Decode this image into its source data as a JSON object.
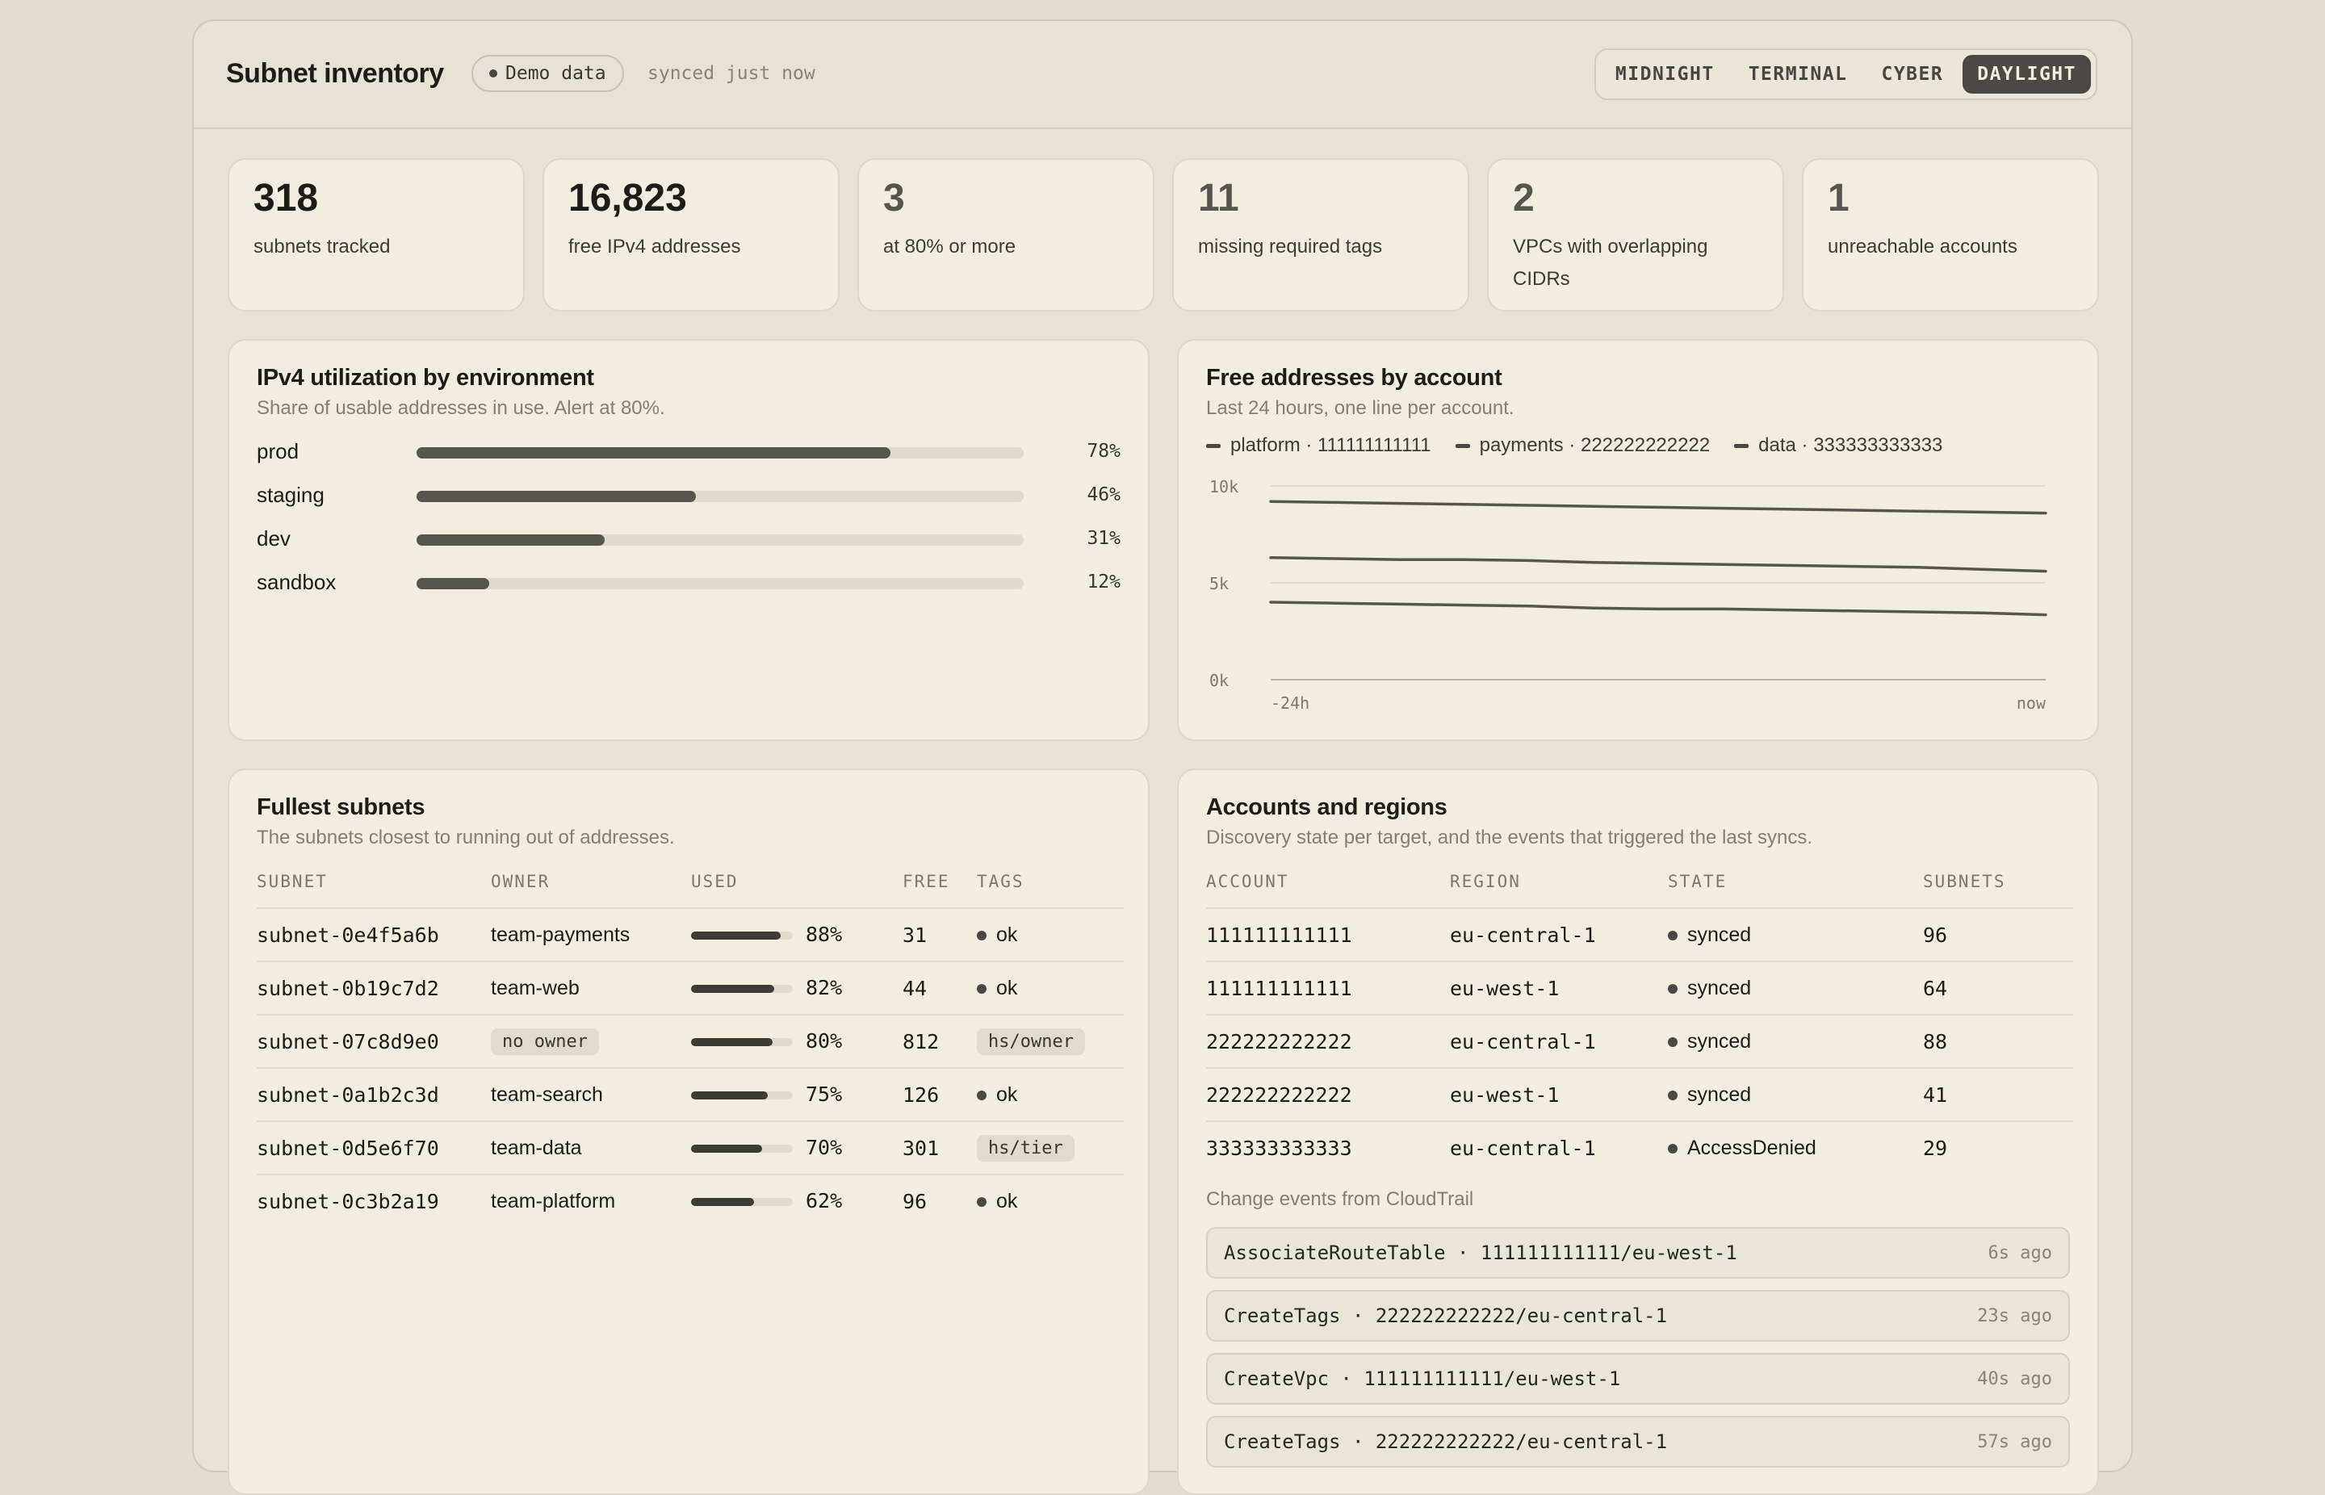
{
  "header": {
    "title": "Subnet inventory",
    "badge": "Demo data",
    "synced": "synced just now",
    "themes": [
      "MIDNIGHT",
      "TERMINAL",
      "CYBER",
      "DAYLIGHT"
    ],
    "active_theme": "DAYLIGHT"
  },
  "stats": [
    {
      "value": "318",
      "label": "subnets tracked"
    },
    {
      "value": "16,823",
      "label": "free IPv4 addresses"
    },
    {
      "value": "3",
      "label": "at 80% or more"
    },
    {
      "value": "11",
      "label": "missing required tags"
    },
    {
      "value": "2",
      "label": "VPCs with overlapping CIDRs"
    },
    {
      "value": "1",
      "label": "unreachable accounts"
    }
  ],
  "utilization": {
    "title": "IPv4 utilization by environment",
    "subtitle": "Share of usable addresses in use. Alert at 80%.",
    "rows": [
      {
        "env": "prod",
        "pct": 78,
        "pct_label": "78%"
      },
      {
        "env": "staging",
        "pct": 46,
        "pct_label": "46%"
      },
      {
        "env": "dev",
        "pct": 31,
        "pct_label": "31%"
      },
      {
        "env": "sandbox",
        "pct": 12,
        "pct_label": "12%"
      }
    ]
  },
  "free_chart": {
    "title": "Free addresses by account",
    "subtitle": "Last 24 hours, one line per account."
  },
  "chart_data": {
    "type": "line",
    "title": "Free addresses by account",
    "x": [
      "-24h",
      "-22h",
      "-20h",
      "-18h",
      "-16h",
      "-14h",
      "-12h",
      "-10h",
      "-8h",
      "-6h",
      "-4h",
      "-2h",
      "now"
    ],
    "x_tick_labels": [
      "-24h",
      "now"
    ],
    "y_tick_labels": [
      "10k",
      "5k",
      "0k"
    ],
    "ylim": [
      0,
      10000
    ],
    "grid": true,
    "legend_position": "top-left",
    "series": [
      {
        "name": "platform · 111111111111",
        "values": [
          9200,
          9150,
          9100,
          9050,
          9000,
          8950,
          8900,
          8850,
          8800,
          8750,
          8700,
          8650,
          8600
        ]
      },
      {
        "name": "payments · 222222222222",
        "values": [
          6300,
          6250,
          6200,
          6200,
          6150,
          6050,
          6000,
          5950,
          5900,
          5850,
          5800,
          5700,
          5600
        ]
      },
      {
        "name": "data · 333333333333",
        "values": [
          4000,
          3950,
          3900,
          3850,
          3800,
          3700,
          3650,
          3650,
          3600,
          3550,
          3500,
          3450,
          3350
        ]
      }
    ]
  },
  "fullest": {
    "title": "Fullest subnets",
    "subtitle": "The subnets closest to running out of addresses.",
    "columns": [
      "SUBNET",
      "OWNER",
      "USED",
      "FREE",
      "TAGS"
    ],
    "rows": [
      {
        "subnet": "subnet-0e4f5a6b",
        "owner": "team-payments",
        "owner_missing": false,
        "used": 88,
        "used_label": "88%",
        "free": "31",
        "tags": "ok",
        "tags_issue": false
      },
      {
        "subnet": "subnet-0b19c7d2",
        "owner": "team-web",
        "owner_missing": false,
        "used": 82,
        "used_label": "82%",
        "free": "44",
        "tags": "ok",
        "tags_issue": false
      },
      {
        "subnet": "subnet-07c8d9e0",
        "owner": "no owner",
        "owner_missing": true,
        "used": 80,
        "used_label": "80%",
        "free": "812",
        "tags": "hs/owner",
        "tags_issue": true
      },
      {
        "subnet": "subnet-0a1b2c3d",
        "owner": "team-search",
        "owner_missing": false,
        "used": 75,
        "used_label": "75%",
        "free": "126",
        "tags": "ok",
        "tags_issue": false
      },
      {
        "subnet": "subnet-0d5e6f70",
        "owner": "team-data",
        "owner_missing": false,
        "used": 70,
        "used_label": "70%",
        "free": "301",
        "tags": "hs/tier",
        "tags_issue": true
      },
      {
        "subnet": "subnet-0c3b2a19",
        "owner": "team-platform",
        "owner_missing": false,
        "used": 62,
        "used_label": "62%",
        "free": "96",
        "tags": "ok",
        "tags_issue": false
      }
    ]
  },
  "accounts": {
    "title": "Accounts and regions",
    "subtitle": "Discovery state per target, and the events that triggered the last syncs.",
    "columns": [
      "ACCOUNT",
      "REGION",
      "STATE",
      "SUBNETS"
    ],
    "rows": [
      {
        "account": "111111111111",
        "region": "eu-central-1",
        "state": "synced",
        "subnets": "96"
      },
      {
        "account": "111111111111",
        "region": "eu-west-1",
        "state": "synced",
        "subnets": "64"
      },
      {
        "account": "222222222222",
        "region": "eu-central-1",
        "state": "synced",
        "subnets": "88"
      },
      {
        "account": "222222222222",
        "region": "eu-west-1",
        "state": "synced",
        "subnets": "41"
      },
      {
        "account": "333333333333",
        "region": "eu-central-1",
        "state": "AccessDenied",
        "subnets": "29"
      }
    ],
    "events_title": "Change events from CloudTrail",
    "events": [
      {
        "text": "AssociateRouteTable · 111111111111/eu-west-1",
        "time": "6s ago"
      },
      {
        "text": "CreateTags · 222222222222/eu-central-1",
        "time": "23s ago"
      },
      {
        "text": "CreateVpc · 111111111111/eu-west-1",
        "time": "40s ago"
      },
      {
        "text": "CreateTags · 222222222222/eu-central-1",
        "time": "57s ago"
      }
    ]
  }
}
